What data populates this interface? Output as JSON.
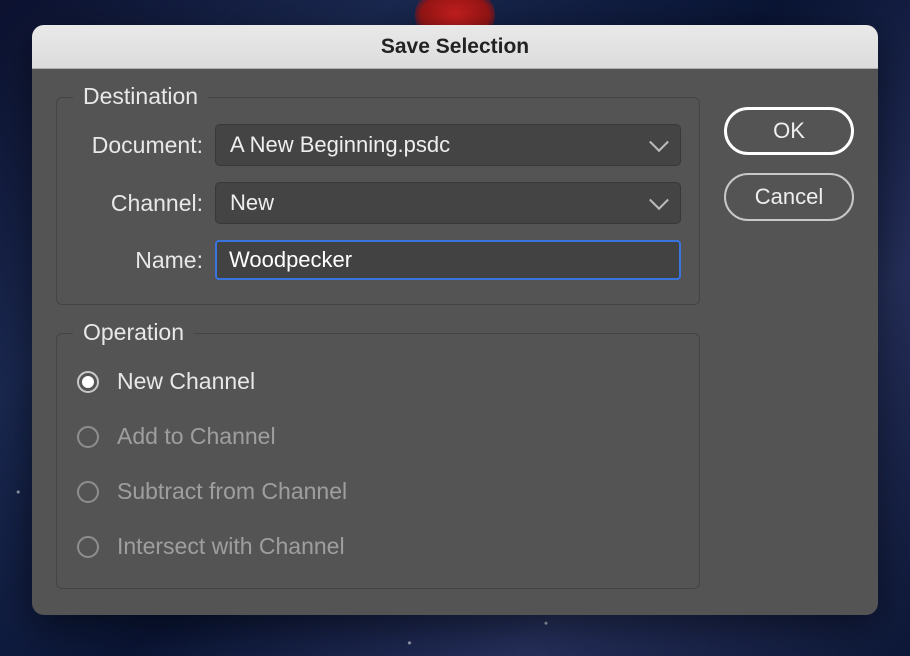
{
  "dialog": {
    "title": "Save Selection"
  },
  "destination": {
    "legend": "Destination",
    "document_label": "Document:",
    "document_value": "A New Beginning.psdc",
    "channel_label": "Channel:",
    "channel_value": "New",
    "name_label": "Name:",
    "name_value": "Woodpecker"
  },
  "operation": {
    "legend": "Operation",
    "options": {
      "new": "New Channel",
      "add": "Add to Channel",
      "subtract": "Subtract from Channel",
      "intersect": "Intersect with Channel"
    }
  },
  "buttons": {
    "ok": "OK",
    "cancel": "Cancel"
  }
}
